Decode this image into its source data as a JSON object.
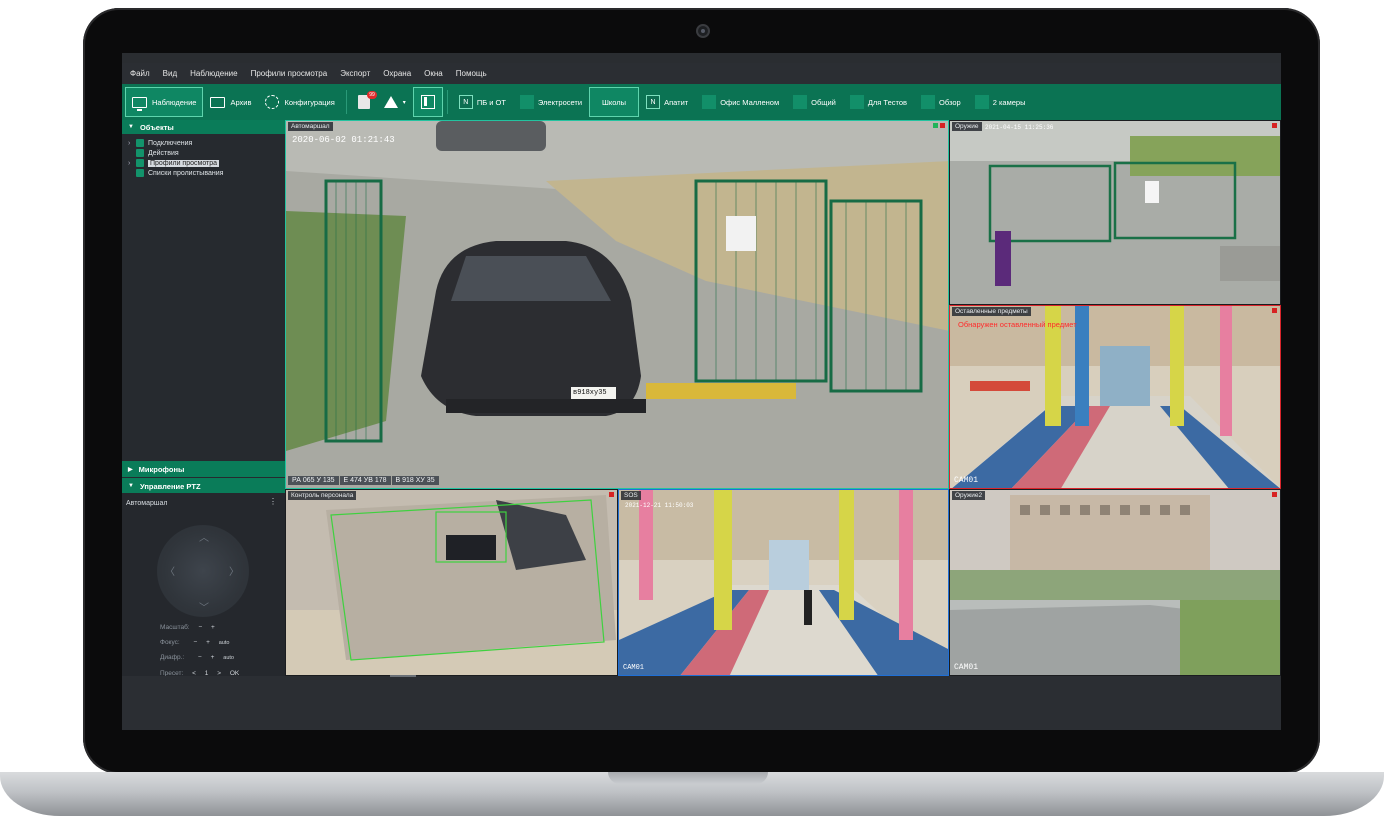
{
  "menu": [
    "Файл",
    "Вид",
    "Наблюдение",
    "Профили просмотра",
    "Экспорт",
    "Охрана",
    "Окна",
    "Помощь"
  ],
  "toolbar": {
    "observe": "Наблюдение",
    "archive": "Архив",
    "config": "Конфигурация",
    "journal_badge": "99",
    "layouts": [
      {
        "label": "ПБ и ОТ",
        "n": true
      },
      {
        "label": "Электросети",
        "n": false
      },
      {
        "label": "Школы",
        "n": false,
        "active": true
      },
      {
        "label": "Апатит",
        "n": true
      },
      {
        "label": "Офис Малленом",
        "n": false
      },
      {
        "label": "Общий",
        "n": false
      },
      {
        "label": "Для Тестов",
        "n": false
      },
      {
        "label": "Обзор",
        "n": false
      },
      {
        "label": "2 камеры",
        "n": false
      }
    ],
    "n_letter": "N"
  },
  "sidebar": {
    "objects_header": "Объекты",
    "tree": [
      {
        "label": "Подключения",
        "expandable": true
      },
      {
        "label": "Действия",
        "expandable": false
      },
      {
        "label": "Профили просмотра",
        "expandable": true,
        "selected": true
      },
      {
        "label": "Списки пролистывания",
        "expandable": false
      }
    ],
    "mics_header": "Микрофоны",
    "ptz_header": "Управление PTZ"
  },
  "ptz": {
    "camera": "Автомаршал",
    "menu_glyph": "⋮",
    "scale_label": "Масштаб:",
    "focus_label": "Фокус:",
    "iris_label": "Диафр.:",
    "preset_label": "Пресет:",
    "minus": "−",
    "plus": "+",
    "auto": "auto",
    "preset_prev": "<",
    "preset_value": "1",
    "preset_next": ">",
    "ok": "OK"
  },
  "cameras": {
    "main": {
      "label": "Автомаршал",
      "osd_time": "2020-06-02  01:21:43",
      "plates": [
        "РА 065 У 135",
        "Е 474 УВ 178",
        "В 918 ХУ 35"
      ],
      "car_plate": "в918ху35"
    },
    "top_right": {
      "label": "Оружие",
      "osd": "2021-04-15 11:25:36"
    },
    "mid_right": {
      "label": "Оставленные предметы",
      "alarm": "Обнаружен оставленный предмет",
      "corner": "CAM01"
    },
    "bl": {
      "label": "Контроль персонала"
    },
    "bm": {
      "label": "SOS",
      "osd": "2021-12-21 11:50:03",
      "corner": "CAM01"
    },
    "br": {
      "label": "Оружие2",
      "corner": "CAM01"
    }
  },
  "colors": {
    "accent": "#0b7353",
    "alarm": "#d9242b",
    "focus": "#23c3a0"
  }
}
